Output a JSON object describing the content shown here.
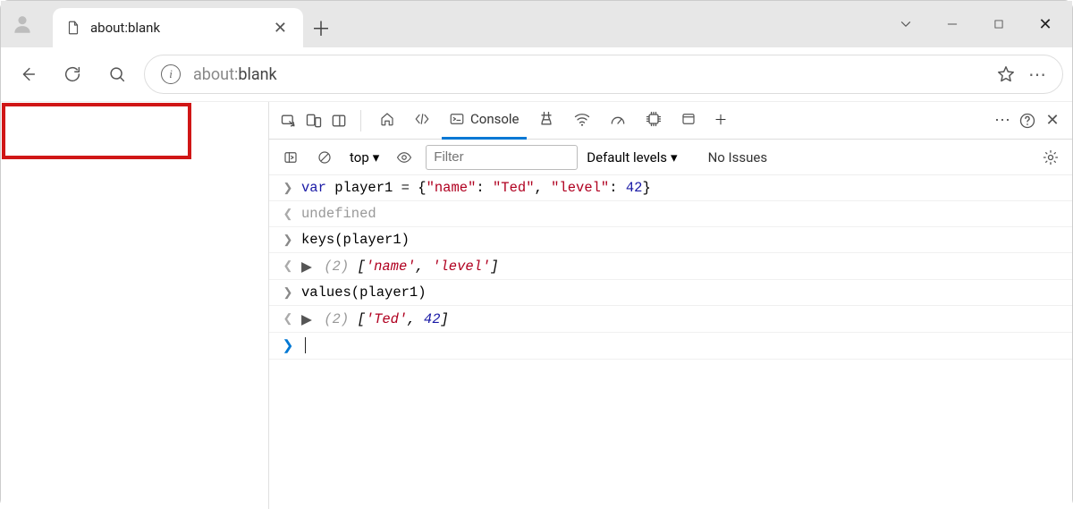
{
  "window": {
    "tab_title": "about:blank",
    "url_prefix": "about:",
    "url_rest": "blank"
  },
  "devtools": {
    "active_tab": "Console",
    "filter_placeholder": "Filter",
    "context": "top",
    "levels_label": "Default levels",
    "issues_label": "No Issues"
  },
  "console": {
    "rows": [
      {
        "kind": "in",
        "html": "<span class='kw'>var</span> <span>player1</span> <span class='op'>=</span> {<span class='str'>\"name\"</span>: <span class='str'>\"Ted\"</span>, <span class='str'>\"level\"</span>: <span class='num'>42</span>}"
      },
      {
        "kind": "out",
        "html": "<span class='muted'>undefined</span>"
      },
      {
        "kind": "in",
        "html": "keys(player1)"
      },
      {
        "kind": "out",
        "expand": true,
        "html": "<span class='muted ital'>(2)</span> <span class='ital'>[<span class='str'>'name'</span>, <span class='str'>'level'</span>]</span>"
      },
      {
        "kind": "in",
        "html": "values(player1)"
      },
      {
        "kind": "out",
        "expand": true,
        "html": "<span class='muted ital'>(2)</span> <span class='ital'>[<span class='str'>'Ted'</span>, <span class='num'>42</span>]</span>"
      }
    ],
    "highlight_rows": [
      4,
      5
    ]
  }
}
